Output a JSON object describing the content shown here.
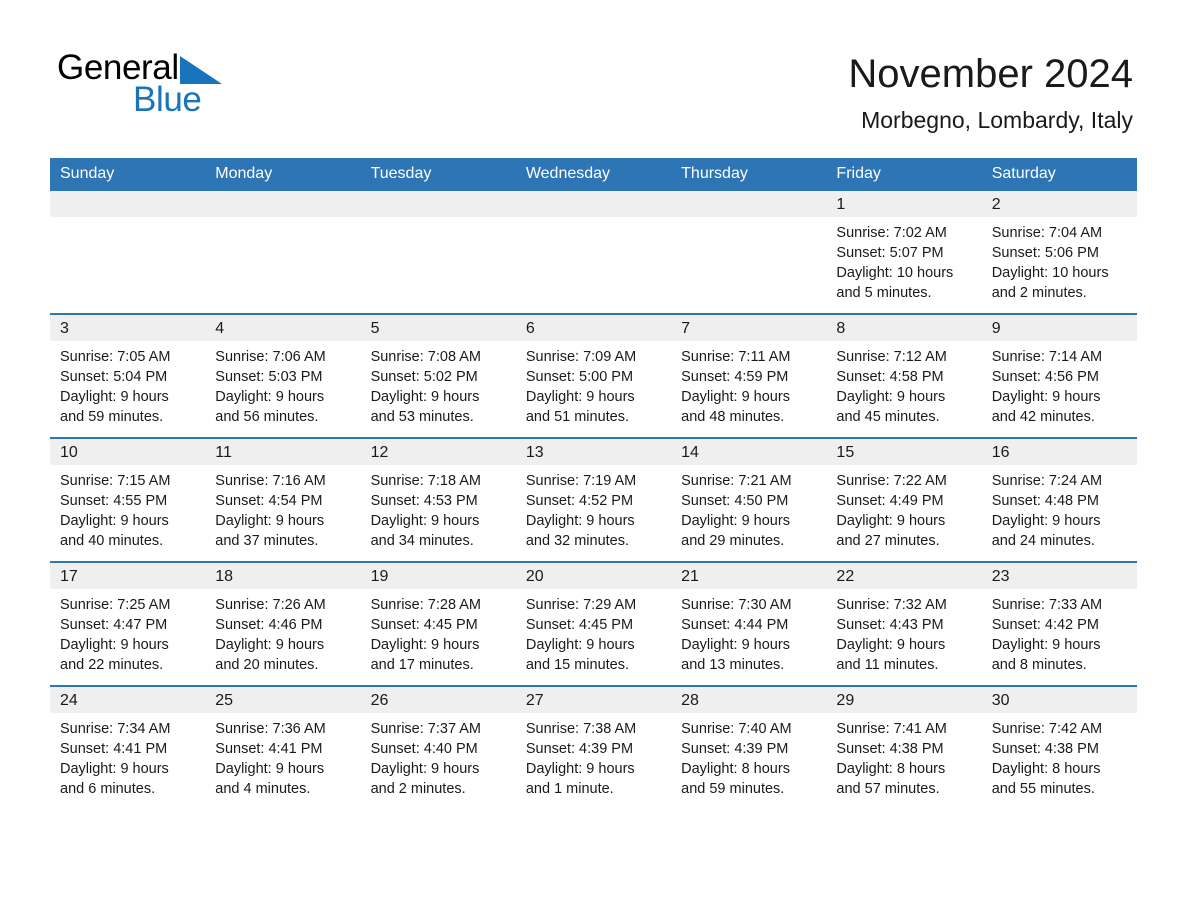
{
  "brand": {
    "logo_text_1": "General",
    "logo_text_2": "Blue",
    "accent_color": "#1a74bb",
    "header_color": "#2e75b6",
    "date_band_color": "#efefef"
  },
  "header": {
    "title": "November 2024",
    "subtitle": "Morbegno, Lombardy, Italy"
  },
  "calendar": {
    "day_headers": [
      "Sunday",
      "Monday",
      "Tuesday",
      "Wednesday",
      "Thursday",
      "Friday",
      "Saturday"
    ],
    "weeks": [
      [
        {
          "day": "",
          "sunrise": "",
          "sunset": "",
          "daylight_1": "",
          "daylight_2": ""
        },
        {
          "day": "",
          "sunrise": "",
          "sunset": "",
          "daylight_1": "",
          "daylight_2": ""
        },
        {
          "day": "",
          "sunrise": "",
          "sunset": "",
          "daylight_1": "",
          "daylight_2": ""
        },
        {
          "day": "",
          "sunrise": "",
          "sunset": "",
          "daylight_1": "",
          "daylight_2": ""
        },
        {
          "day": "",
          "sunrise": "",
          "sunset": "",
          "daylight_1": "",
          "daylight_2": ""
        },
        {
          "day": "1",
          "sunrise": "Sunrise: 7:02 AM",
          "sunset": "Sunset: 5:07 PM",
          "daylight_1": "Daylight: 10 hours",
          "daylight_2": "and 5 minutes."
        },
        {
          "day": "2",
          "sunrise": "Sunrise: 7:04 AM",
          "sunset": "Sunset: 5:06 PM",
          "daylight_1": "Daylight: 10 hours",
          "daylight_2": "and 2 minutes."
        }
      ],
      [
        {
          "day": "3",
          "sunrise": "Sunrise: 7:05 AM",
          "sunset": "Sunset: 5:04 PM",
          "daylight_1": "Daylight: 9 hours",
          "daylight_2": "and 59 minutes."
        },
        {
          "day": "4",
          "sunrise": "Sunrise: 7:06 AM",
          "sunset": "Sunset: 5:03 PM",
          "daylight_1": "Daylight: 9 hours",
          "daylight_2": "and 56 minutes."
        },
        {
          "day": "5",
          "sunrise": "Sunrise: 7:08 AM",
          "sunset": "Sunset: 5:02 PM",
          "daylight_1": "Daylight: 9 hours",
          "daylight_2": "and 53 minutes."
        },
        {
          "day": "6",
          "sunrise": "Sunrise: 7:09 AM",
          "sunset": "Sunset: 5:00 PM",
          "daylight_1": "Daylight: 9 hours",
          "daylight_2": "and 51 minutes."
        },
        {
          "day": "7",
          "sunrise": "Sunrise: 7:11 AM",
          "sunset": "Sunset: 4:59 PM",
          "daylight_1": "Daylight: 9 hours",
          "daylight_2": "and 48 minutes."
        },
        {
          "day": "8",
          "sunrise": "Sunrise: 7:12 AM",
          "sunset": "Sunset: 4:58 PM",
          "daylight_1": "Daylight: 9 hours",
          "daylight_2": "and 45 minutes."
        },
        {
          "day": "9",
          "sunrise": "Sunrise: 7:14 AM",
          "sunset": "Sunset: 4:56 PM",
          "daylight_1": "Daylight: 9 hours",
          "daylight_2": "and 42 minutes."
        }
      ],
      [
        {
          "day": "10",
          "sunrise": "Sunrise: 7:15 AM",
          "sunset": "Sunset: 4:55 PM",
          "daylight_1": "Daylight: 9 hours",
          "daylight_2": "and 40 minutes."
        },
        {
          "day": "11",
          "sunrise": "Sunrise: 7:16 AM",
          "sunset": "Sunset: 4:54 PM",
          "daylight_1": "Daylight: 9 hours",
          "daylight_2": "and 37 minutes."
        },
        {
          "day": "12",
          "sunrise": "Sunrise: 7:18 AM",
          "sunset": "Sunset: 4:53 PM",
          "daylight_1": "Daylight: 9 hours",
          "daylight_2": "and 34 minutes."
        },
        {
          "day": "13",
          "sunrise": "Sunrise: 7:19 AM",
          "sunset": "Sunset: 4:52 PM",
          "daylight_1": "Daylight: 9 hours",
          "daylight_2": "and 32 minutes."
        },
        {
          "day": "14",
          "sunrise": "Sunrise: 7:21 AM",
          "sunset": "Sunset: 4:50 PM",
          "daylight_1": "Daylight: 9 hours",
          "daylight_2": "and 29 minutes."
        },
        {
          "day": "15",
          "sunrise": "Sunrise: 7:22 AM",
          "sunset": "Sunset: 4:49 PM",
          "daylight_1": "Daylight: 9 hours",
          "daylight_2": "and 27 minutes."
        },
        {
          "day": "16",
          "sunrise": "Sunrise: 7:24 AM",
          "sunset": "Sunset: 4:48 PM",
          "daylight_1": "Daylight: 9 hours",
          "daylight_2": "and 24 minutes."
        }
      ],
      [
        {
          "day": "17",
          "sunrise": "Sunrise: 7:25 AM",
          "sunset": "Sunset: 4:47 PM",
          "daylight_1": "Daylight: 9 hours",
          "daylight_2": "and 22 minutes."
        },
        {
          "day": "18",
          "sunrise": "Sunrise: 7:26 AM",
          "sunset": "Sunset: 4:46 PM",
          "daylight_1": "Daylight: 9 hours",
          "daylight_2": "and 20 minutes."
        },
        {
          "day": "19",
          "sunrise": "Sunrise: 7:28 AM",
          "sunset": "Sunset: 4:45 PM",
          "daylight_1": "Daylight: 9 hours",
          "daylight_2": "and 17 minutes."
        },
        {
          "day": "20",
          "sunrise": "Sunrise: 7:29 AM",
          "sunset": "Sunset: 4:45 PM",
          "daylight_1": "Daylight: 9 hours",
          "daylight_2": "and 15 minutes."
        },
        {
          "day": "21",
          "sunrise": "Sunrise: 7:30 AM",
          "sunset": "Sunset: 4:44 PM",
          "daylight_1": "Daylight: 9 hours",
          "daylight_2": "and 13 minutes."
        },
        {
          "day": "22",
          "sunrise": "Sunrise: 7:32 AM",
          "sunset": "Sunset: 4:43 PM",
          "daylight_1": "Daylight: 9 hours",
          "daylight_2": "and 11 minutes."
        },
        {
          "day": "23",
          "sunrise": "Sunrise: 7:33 AM",
          "sunset": "Sunset: 4:42 PM",
          "daylight_1": "Daylight: 9 hours",
          "daylight_2": "and 8 minutes."
        }
      ],
      [
        {
          "day": "24",
          "sunrise": "Sunrise: 7:34 AM",
          "sunset": "Sunset: 4:41 PM",
          "daylight_1": "Daylight: 9 hours",
          "daylight_2": "and 6 minutes."
        },
        {
          "day": "25",
          "sunrise": "Sunrise: 7:36 AM",
          "sunset": "Sunset: 4:41 PM",
          "daylight_1": "Daylight: 9 hours",
          "daylight_2": "and 4 minutes."
        },
        {
          "day": "26",
          "sunrise": "Sunrise: 7:37 AM",
          "sunset": "Sunset: 4:40 PM",
          "daylight_1": "Daylight: 9 hours",
          "daylight_2": "and 2 minutes."
        },
        {
          "day": "27",
          "sunrise": "Sunrise: 7:38 AM",
          "sunset": "Sunset: 4:39 PM",
          "daylight_1": "Daylight: 9 hours",
          "daylight_2": "and 1 minute."
        },
        {
          "day": "28",
          "sunrise": "Sunrise: 7:40 AM",
          "sunset": "Sunset: 4:39 PM",
          "daylight_1": "Daylight: 8 hours",
          "daylight_2": "and 59 minutes."
        },
        {
          "day": "29",
          "sunrise": "Sunrise: 7:41 AM",
          "sunset": "Sunset: 4:38 PM",
          "daylight_1": "Daylight: 8 hours",
          "daylight_2": "and 57 minutes."
        },
        {
          "day": "30",
          "sunrise": "Sunrise: 7:42 AM",
          "sunset": "Sunset: 4:38 PM",
          "daylight_1": "Daylight: 8 hours",
          "daylight_2": "and 55 minutes."
        }
      ]
    ]
  }
}
